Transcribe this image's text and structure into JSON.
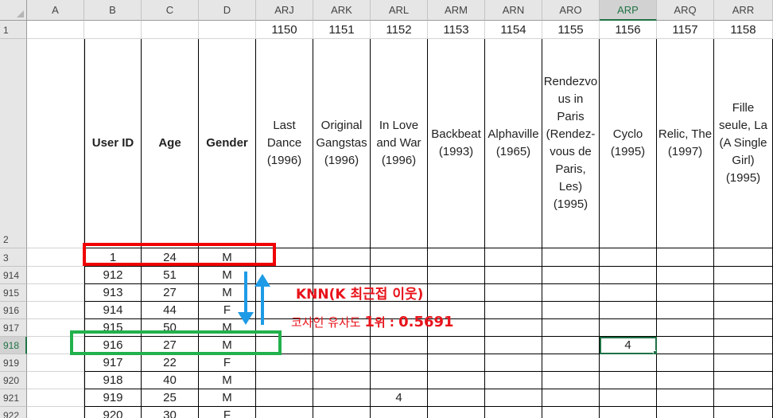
{
  "columns": [
    "A",
    "B",
    "C",
    "D",
    "ARJ",
    "ARK",
    "ARL",
    "ARM",
    "ARN",
    "ARO",
    "ARP",
    "ARQ",
    "ARR"
  ],
  "selected_column": "ARP",
  "row_numbers": [
    "1",
    "2",
    "3",
    "914",
    "915",
    "916",
    "917",
    "918",
    "919",
    "920",
    "921",
    "922"
  ],
  "selected_row": "918",
  "movie_ids": [
    "1150",
    "1151",
    "1152",
    "1153",
    "1154",
    "1155",
    "1156",
    "1157",
    "1158"
  ],
  "headers": {
    "user_id": "User ID",
    "age": "Age",
    "gender": "Gender"
  },
  "movie_titles": [
    "Last\nDance\n(1996)",
    "Original\nGangstas\n(1996)",
    "In Love\nand War\n(1996)",
    "Backbeat\n(1993)",
    "Alphaville\n(1965)",
    "Rendezvo\nus in\nParis\n(Rendez-\nvous de\nParis, Les)\n(1995)",
    "Cyclo\n(1995)",
    "Relic, The\n(1997)",
    "Fille\nseule, La\n(A Single\nGirl)\n(1995)"
  ],
  "rows": [
    {
      "user_id": "1",
      "age": "24",
      "gender": "M"
    },
    {
      "user_id": "912",
      "age": "51",
      "gender": "M"
    },
    {
      "user_id": "913",
      "age": "27",
      "gender": "M"
    },
    {
      "user_id": "914",
      "age": "44",
      "gender": "F"
    },
    {
      "user_id": "915",
      "age": "50",
      "gender": "M"
    },
    {
      "user_id": "916",
      "age": "27",
      "gender": "M"
    },
    {
      "user_id": "917",
      "age": "22",
      "gender": "F"
    },
    {
      "user_id": "918",
      "age": "40",
      "gender": "M"
    },
    {
      "user_id": "919",
      "age": "25",
      "gender": "M"
    },
    {
      "user_id": "920",
      "age": "30",
      "gender": "F"
    }
  ],
  "ratings": {
    "row_918_ARP": "4",
    "row_921_ARL": "4"
  },
  "annotation": {
    "title": "KNN(K 최근접 이웃)",
    "subtitle_prefix": "코사인 유사도 ",
    "subtitle_rank": "1",
    "subtitle_rank_suffix": "위 : ",
    "subtitle_value": "0.5691"
  },
  "colors": {
    "red_box": "#f00000",
    "green_box": "#22b14c",
    "arrow": "#1e9be6",
    "annotation_text": "#e8121a",
    "selection": "#217346"
  }
}
